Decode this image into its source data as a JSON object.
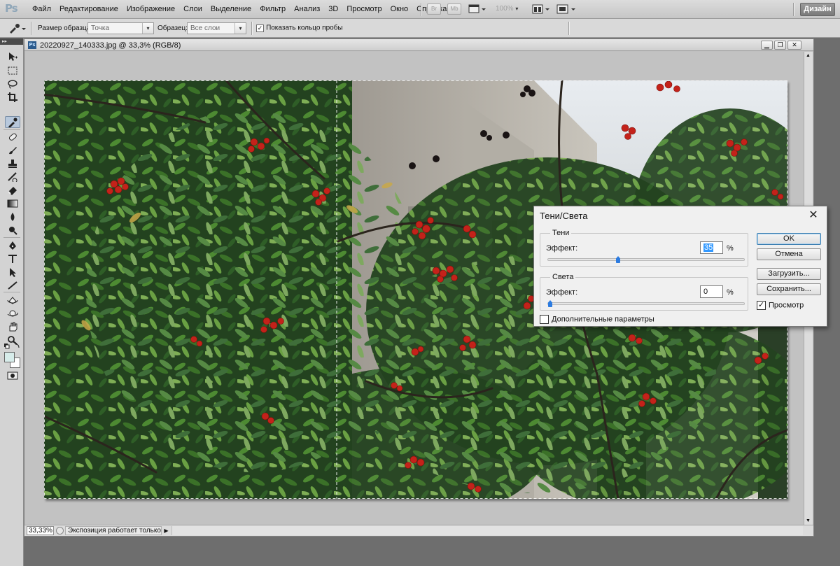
{
  "app": {
    "logo": "Ps"
  },
  "menubar": {
    "items": [
      "Файл",
      "Редактирование",
      "Изображение",
      "Слои",
      "Выделение",
      "Фильтр",
      "Анализ",
      "3D",
      "Просмотр",
      "Окно",
      "Справка"
    ],
    "icon_br": "Br",
    "icon_mb": "Mb",
    "zoom": "100%",
    "workspace": "Дизайн"
  },
  "options": {
    "sample_size_label": "Размер образца:",
    "sample_size_value": "Точка",
    "sample_label": "Образец:",
    "sample_value": "Все слои",
    "show_ring_label": "Показать кольцо пробы",
    "show_ring_checked": true
  },
  "document": {
    "title": "20220927_140333.jpg @ 33,3% (RGB/8)",
    "ps_icon": "Ps",
    "zoom": "33,33%",
    "status": "Экспозиция работает только ..."
  },
  "tools": [
    "move-tool",
    "marquee-tool",
    "lasso-tool",
    "crop-tool",
    "eyedropper-tool",
    "healing-brush-tool",
    "brush-tool",
    "clone-stamp-tool",
    "history-brush-tool",
    "eraser-tool",
    "gradient-tool",
    "blur-tool",
    "dodge-tool",
    "pen-tool",
    "type-tool",
    "path-selection-tool",
    "line-tool",
    "3d-rotate-tool",
    "3d-orbit-tool",
    "hand-tool",
    "zoom-tool"
  ],
  "dialog": {
    "title": "Тени/Света",
    "shadows": {
      "legend": "Тени",
      "effect_label": "Эффект:",
      "value": "35",
      "unit": "%",
      "level": 0.35
    },
    "highlights": {
      "legend": "Света",
      "effect_label": "Эффект:",
      "value": "0",
      "unit": "%",
      "level": 0.0
    },
    "more_options": "Дополнительные параметры",
    "more_options_checked": false,
    "ok": "OK",
    "cancel": "Отмена",
    "load": "Загрузить...",
    "save": "Сохранить...",
    "preview": "Просмотр",
    "preview_checked": true
  },
  "colors": {
    "accent": "#2c7be0",
    "foliage_dark": "#1f3a1c",
    "foliage_light": "#4f8a33",
    "berry": "#c4221a",
    "building": "#b7b3aa"
  }
}
